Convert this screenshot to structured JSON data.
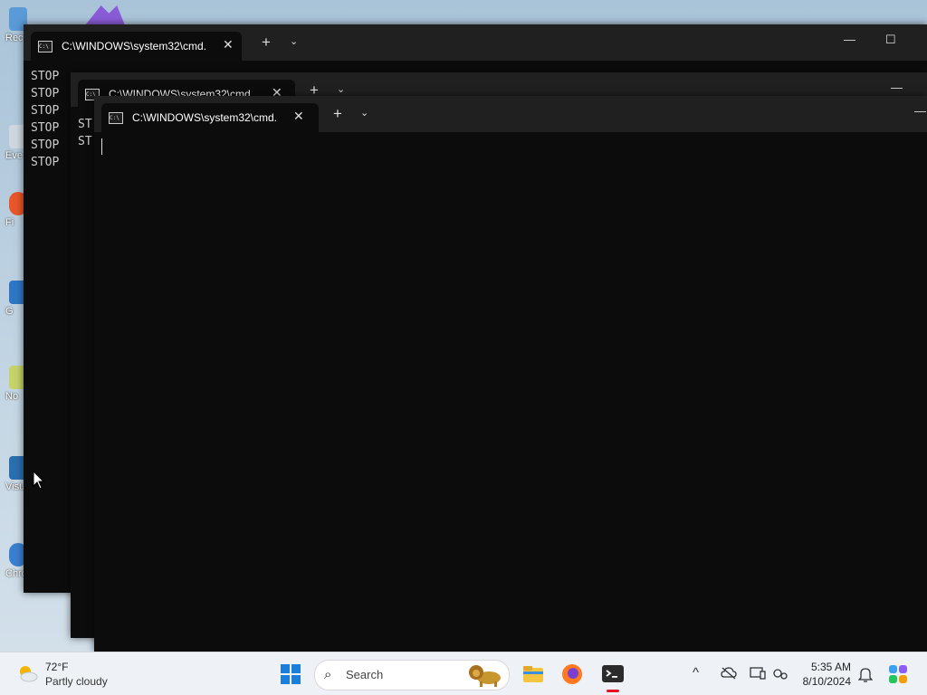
{
  "desktop": {
    "icons": [
      {
        "label": "Rec",
        "icon": "recycle-bin-icon",
        "color": "#5a9ad6"
      },
      {
        "label": "Eve",
        "icon": "shortcut-icon",
        "color": "#cfd8e0"
      },
      {
        "label": "Fi",
        "icon": "firefox-shortcut-icon",
        "color": "#e8562a"
      },
      {
        "label": "G",
        "icon": "shortcut-icon",
        "color": "#2f77c4"
      },
      {
        "label": "No",
        "icon": "notepad-shortcut-icon",
        "color": "#c6d36a"
      },
      {
        "label": "Visu",
        "icon": "visual-studio-shortcut-icon",
        "color": "#2a6fb0"
      },
      {
        "label": "Chromium",
        "icon": "chromium-shortcut-icon",
        "color": "#3a7fd0"
      }
    ]
  },
  "windows": [
    {
      "tab_title": "C:\\WINDOWS\\system32\\cmd.",
      "lines": [
        "STOP",
        "STOP",
        "STOP",
        "STOP",
        "STOP",
        "STOP"
      ]
    },
    {
      "tab_title": "C:\\WINDOWS\\system32\\cmd.",
      "lines": [
        "ST",
        "ST"
      ]
    },
    {
      "tab_title": "C:\\WINDOWS\\system32\\cmd.",
      "lines": []
    }
  ],
  "glyphs": {
    "close": "✕",
    "plus": "+",
    "chevron": "⌄",
    "minimize": "—",
    "maximize": "☐",
    "cmd": "C:\\"
  },
  "taskbar": {
    "weather_temp": "72°F",
    "weather_desc": "Partly cloudy",
    "search_label": "Search",
    "time": "5:35 AM",
    "date": "8/10/2024",
    "pinned": [
      "file-explorer-icon",
      "firefox-icon",
      "terminal-icon"
    ],
    "tray": [
      "chevron-up-icon",
      "onedrive-icon",
      "display-icon",
      "network-icon",
      "notification-bell-icon",
      "copilot-icon"
    ],
    "colors": {
      "accent": "#1b7fd9",
      "active_indicator": "#e81123"
    }
  }
}
